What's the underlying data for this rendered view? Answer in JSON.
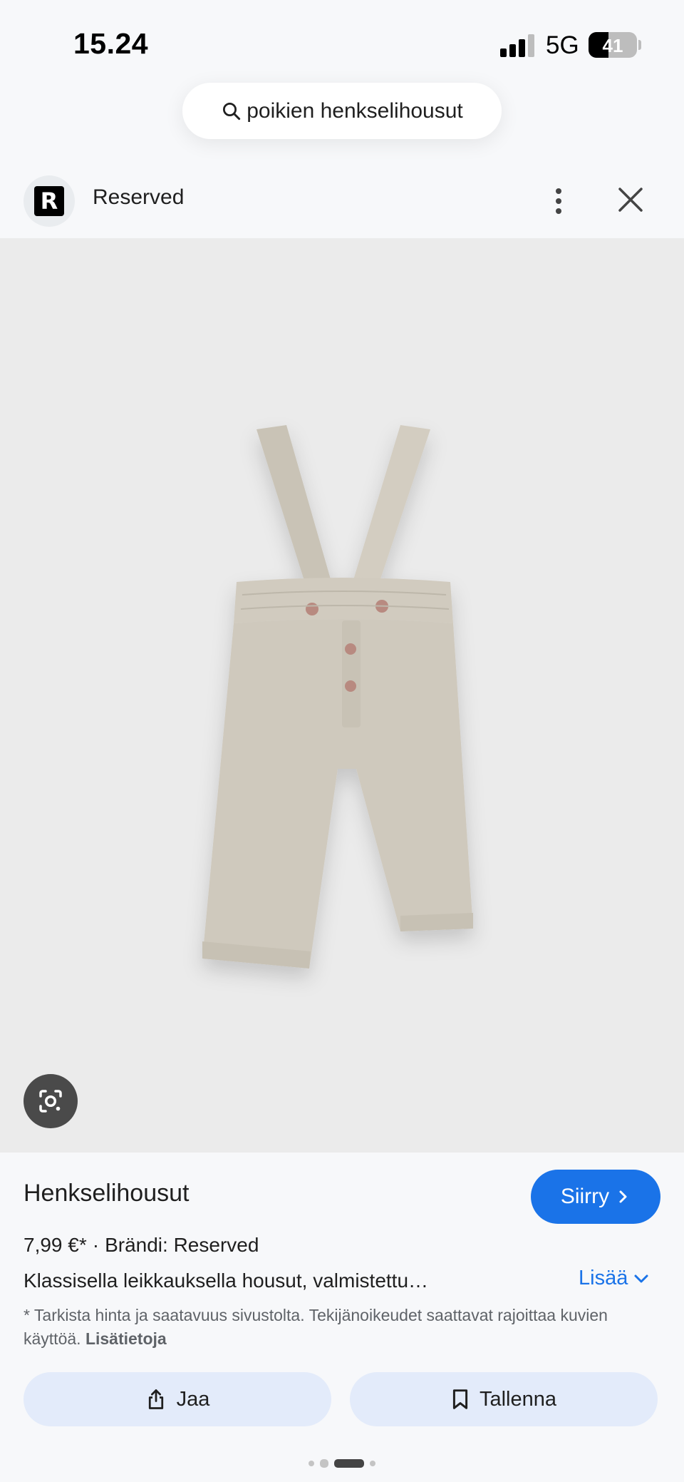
{
  "status_bar": {
    "time": "15.24",
    "network": "5G",
    "battery": "41",
    "battery_level": 0.41
  },
  "search": {
    "query": "poikien henkselihousut"
  },
  "header": {
    "site_name": "Reserved",
    "logo_letter": "R"
  },
  "icons": {
    "search": "search-icon",
    "more": "more-vert-icon",
    "close": "close-icon",
    "lens": "lens-icon",
    "chevron_right": "chevron-right-icon",
    "chevron_down": "chevron-down-icon",
    "share": "share-icon",
    "bookmark": "bookmark-icon"
  },
  "product": {
    "title": "Henkselihousut",
    "visit_label": "Siirry",
    "price": "7,99 €*",
    "separator": "·",
    "brand": "Brändi: Reserved",
    "description": "Klassisella leikkauksella housut, valmistettu…",
    "more_label": "Lisää",
    "disclaimer": "* Tarkista hinta ja saatavuus sivustolta. Tekijänoikeudet saattavat rajoittaa kuvien käyttöä.",
    "disclaimer_link": "Lisätietoja"
  },
  "actions": {
    "share_label": "Jaa",
    "save_label": "Tallenna"
  },
  "pagination": {
    "total": 4,
    "active_index": 2
  },
  "colors": {
    "accent": "#1a73e8",
    "action_bg": "#e3ebfa",
    "background": "#f7f8fa",
    "image_bg": "#ebebeb",
    "fabric": "#cfc9bd"
  }
}
